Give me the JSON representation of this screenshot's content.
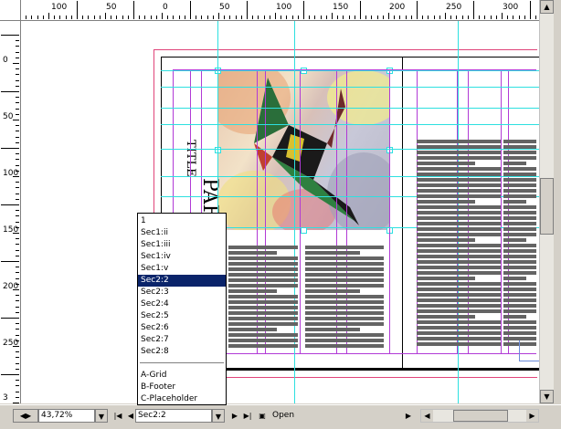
{
  "rulers": {
    "horizontal_labels": [
      "100",
      "50",
      "0",
      "50",
      "100",
      "150",
      "200",
      "250",
      "300"
    ],
    "vertical_labels": [
      "0",
      "50",
      "100",
      "150",
      "200",
      "250",
      "3"
    ]
  },
  "document": {
    "title_text": "TITLE",
    "title_text_large": "PAF"
  },
  "page_menu": {
    "items": [
      "1",
      "Sec1:ii",
      "Sec1:iii",
      "Sec1:iv",
      "Sec1:v",
      "Sec2:2",
      "Sec2:3",
      "Sec2:4",
      "Sec2:5",
      "Sec2:6",
      "Sec2:7",
      "Sec2:8"
    ],
    "selected": "Sec2:2",
    "masters": [
      "A-Grid",
      "B-Footer",
      "C-Placeholder"
    ]
  },
  "status_bar": {
    "zoom_value": "43,72%",
    "page_value": "Sec2:2",
    "open_label": "Open"
  },
  "colors": {
    "margin_guide": "#b13ad6",
    "ruler_guide": "#2de0e0",
    "selection": "#0a246a"
  }
}
